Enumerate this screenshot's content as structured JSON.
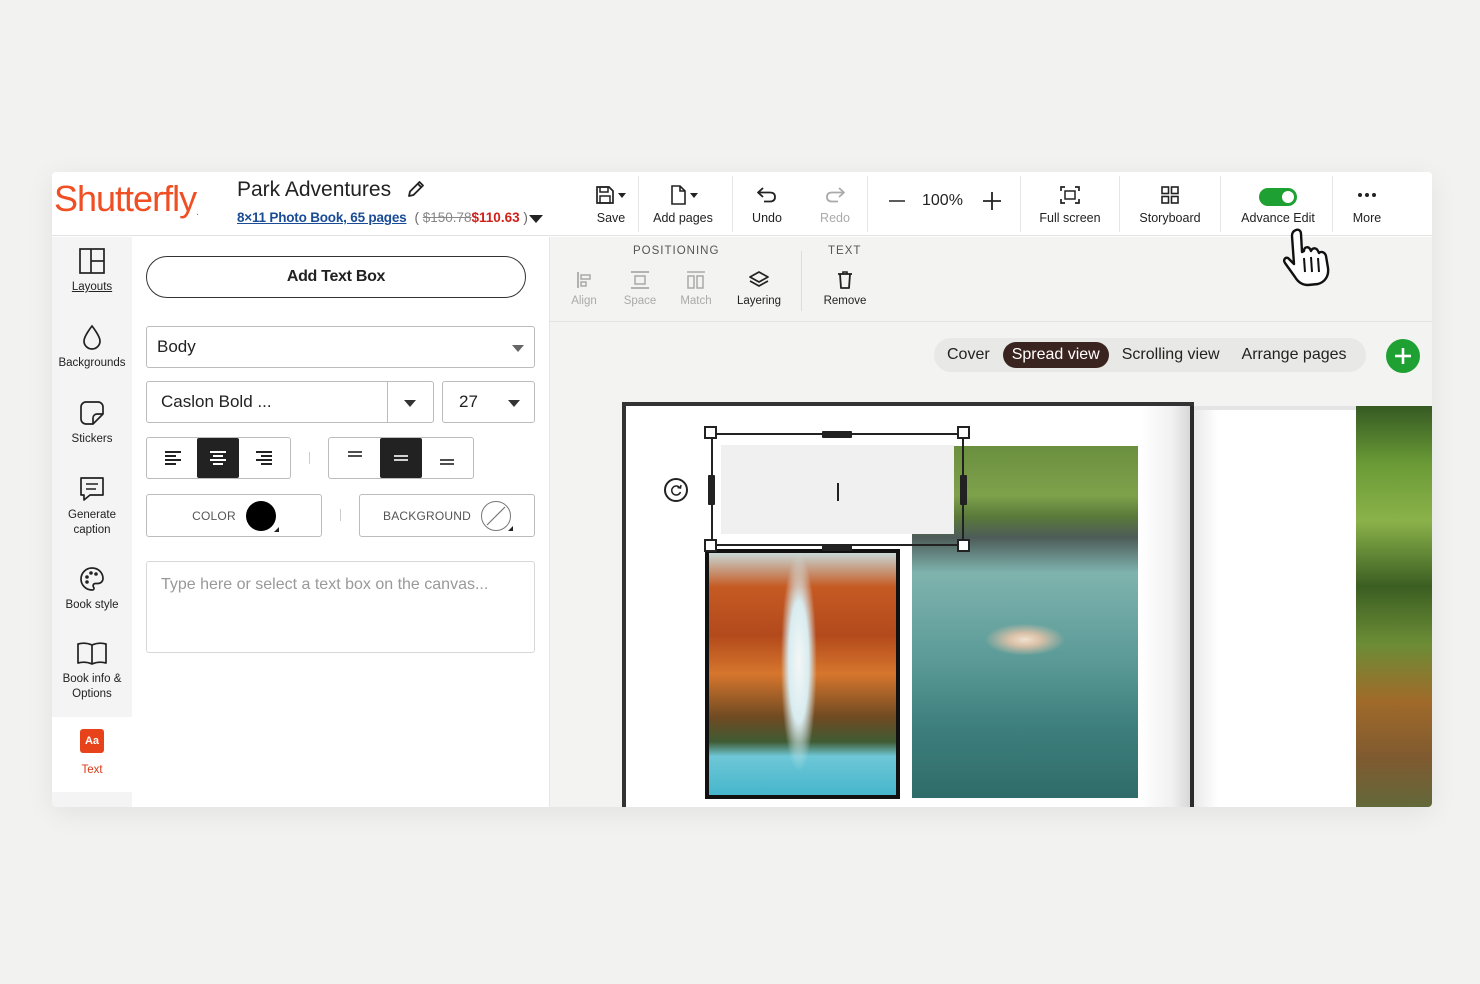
{
  "brand": {
    "logo": "Shutterfly",
    "logo_mark": ".",
    "accent": "#f04e23"
  },
  "project": {
    "title": "Park Adventures",
    "product_link": "8×11 Photo Book, 65 pages",
    "paren_open": "(",
    "paren_close": ")",
    "old_price": "$150.78",
    "new_price": "$110.63"
  },
  "toolbar": {
    "save": "Save",
    "add_pages": "Add pages",
    "undo": "Undo",
    "redo": "Redo",
    "zoom": "100%",
    "full_screen": "Full screen",
    "storyboard": "Storyboard",
    "advance_edit": "Advance Edit",
    "advance_edit_on": true,
    "more": "More"
  },
  "nav": {
    "items": [
      {
        "label": "Layouts",
        "icon": "layout-icon"
      },
      {
        "label": "Backgrounds",
        "icon": "drop-icon"
      },
      {
        "label": "Stickers",
        "icon": "sticker-icon"
      },
      {
        "label": "Generate\ncaption",
        "icon": "caption-icon"
      },
      {
        "label": "Book style",
        "icon": "palette-icon"
      },
      {
        "label": "Book info &\nOptions",
        "icon": "book-icon"
      },
      {
        "label": "Text",
        "icon": "text-icon",
        "icon_text": "Aa",
        "active": true
      }
    ]
  },
  "text_panel": {
    "add_text_box": "Add Text Box",
    "style_value": "Body",
    "font_value": "Caslon Bold ...",
    "size_value": "27",
    "color_label": "COLOR",
    "color_value": "#000000",
    "background_label": "BACKGROUND",
    "placeholder": "Type here or select a text box on the canvas...",
    "h_align_selected": "center",
    "v_align_selected": "middle"
  },
  "subbar": {
    "positioning_label": "POSITIONING",
    "text_label": "TEXT",
    "tools": {
      "align": "Align",
      "space": "Space",
      "match": "Match",
      "layering": "Layering",
      "remove": "Remove"
    }
  },
  "canvas": {
    "views": [
      "Cover",
      "Spread view",
      "Scrolling view",
      "Arrange pages"
    ],
    "active_view": "Spread view"
  }
}
